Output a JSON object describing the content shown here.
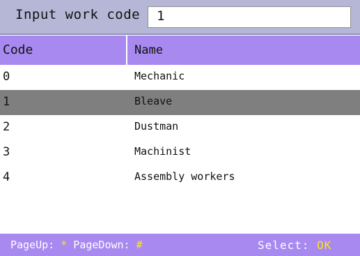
{
  "topbar": {
    "label": "Input work code",
    "input_value": "1"
  },
  "table": {
    "headers": {
      "code": "Code",
      "name": "Name"
    },
    "rows": [
      {
        "code": "0",
        "name": "Mechanic"
      },
      {
        "code": "1",
        "name": "Bleave"
      },
      {
        "code": "2",
        "name": "Dustman"
      },
      {
        "code": "3",
        "name": "Machinist"
      },
      {
        "code": "4",
        "name": "Assembly workers"
      }
    ],
    "selected_index": 1
  },
  "footer": {
    "pageup_label": "PageUp: ",
    "pageup_key": "*",
    "pagedown_label": " PageDown: ",
    "pagedown_key": "#",
    "select_label": "Select: ",
    "select_key": "OK"
  },
  "colors": {
    "topbar_bg": "#b6b6d6",
    "header_bg": "#a889f0",
    "selected_row_bg": "#7f7f7f",
    "key_highlight": "#ffe21a"
  }
}
